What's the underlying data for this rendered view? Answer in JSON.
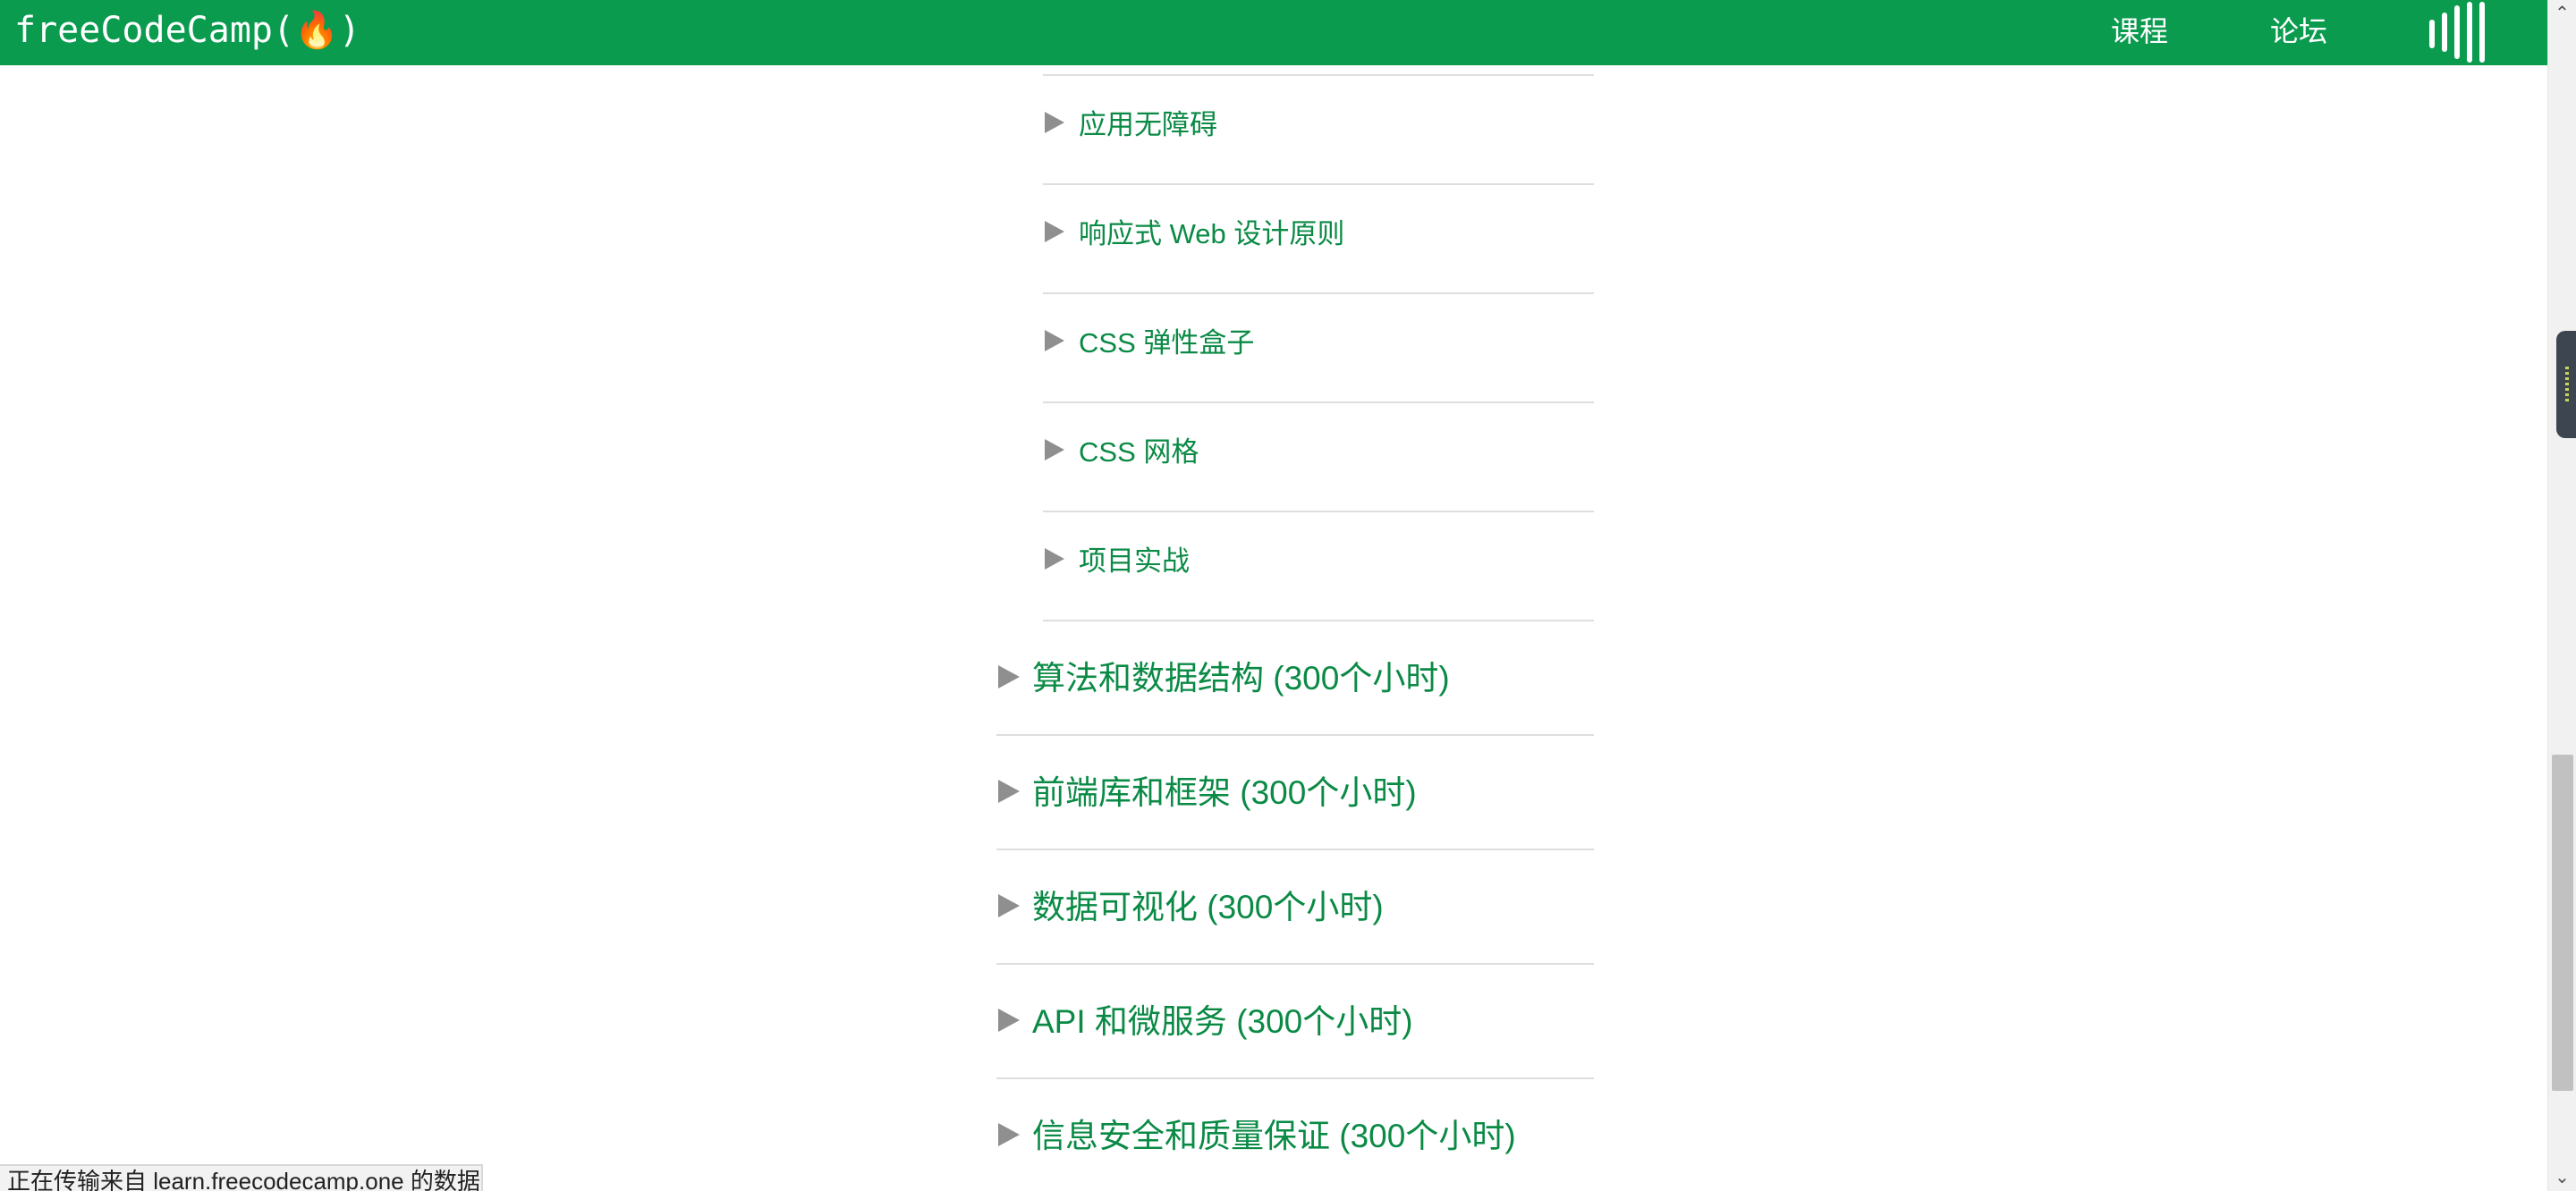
{
  "navbar": {
    "logo": "freeCodeCamp(🔥)",
    "links": [
      "课程",
      "论坛"
    ]
  },
  "sub_items": [
    {
      "label": "应用无障碍"
    },
    {
      "label": "响应式 Web 设计原则"
    },
    {
      "label": "CSS 弹性盒子"
    },
    {
      "label": "CSS 网格"
    },
    {
      "label": "项目实战"
    }
  ],
  "main_items": [
    {
      "label": "算法和数据结构 (300个小时)"
    },
    {
      "label": "前端库和框架 (300个小时)"
    },
    {
      "label": "数据可视化 (300个小时)"
    },
    {
      "label": "API 和微服务 (300个小时)"
    },
    {
      "label": "信息安全和质量保证 (300个小时)"
    }
  ],
  "status_bar": {
    "text": "正在传输来自 learn.freecodecamp.one 的数据..."
  },
  "colors": {
    "brand_green": "#0a9b4f",
    "link_green": "#0a8a45",
    "arrow_gray": "#8f8f8f",
    "divider": "#dedede"
  },
  "icons": {
    "menu": "menu-bars-icon",
    "arrow": "caret-right-icon",
    "scroll_up": "chevron-up-icon",
    "scroll_down": "chevron-down-icon"
  }
}
